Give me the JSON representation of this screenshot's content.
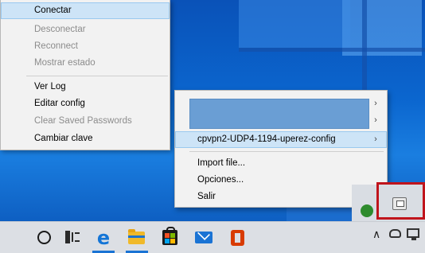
{
  "left_menu": {
    "items": [
      {
        "label": "Conectar",
        "state": "hover"
      },
      {
        "label": "Desconectar",
        "state": "disabled"
      },
      {
        "label": "Reconnect",
        "state": "disabled"
      },
      {
        "label": "Mostrar estado",
        "state": "disabled"
      },
      {
        "label": "Ver Log",
        "state": "enabled"
      },
      {
        "label": "Editar config",
        "state": "enabled"
      },
      {
        "label": "Clear Saved Passwords",
        "state": "disabled"
      },
      {
        "label": "Cambiar clave",
        "state": "enabled"
      }
    ]
  },
  "tray_menu": {
    "submenu_arrow": "›",
    "items": [
      {
        "label": "",
        "redacted": true,
        "has_submenu": true
      },
      {
        "label": "",
        "redacted": true,
        "has_submenu": true
      },
      {
        "label": "cpvpn2-UDP4-1194-uperez-config",
        "has_submenu": true,
        "state": "hover"
      },
      {
        "label": "Import file..."
      },
      {
        "label": "Opciones..."
      },
      {
        "label": "Salir"
      }
    ]
  },
  "taskbar": {
    "pinned": [
      "search-cortana-icon",
      "task-view-icon",
      "edge-icon",
      "file-explorer-icon",
      "store-icon",
      "mail-icon",
      "office-icon"
    ],
    "edge_glyph": "e",
    "tray_chevron": "∧"
  },
  "colors": {
    "menu_bg": "#f2f2f2",
    "hover_bg": "#cde4f7",
    "disabled_text": "#8c8c8c",
    "annotation_red": "#c0141c",
    "redacted_fill": "#6a9ed4"
  }
}
